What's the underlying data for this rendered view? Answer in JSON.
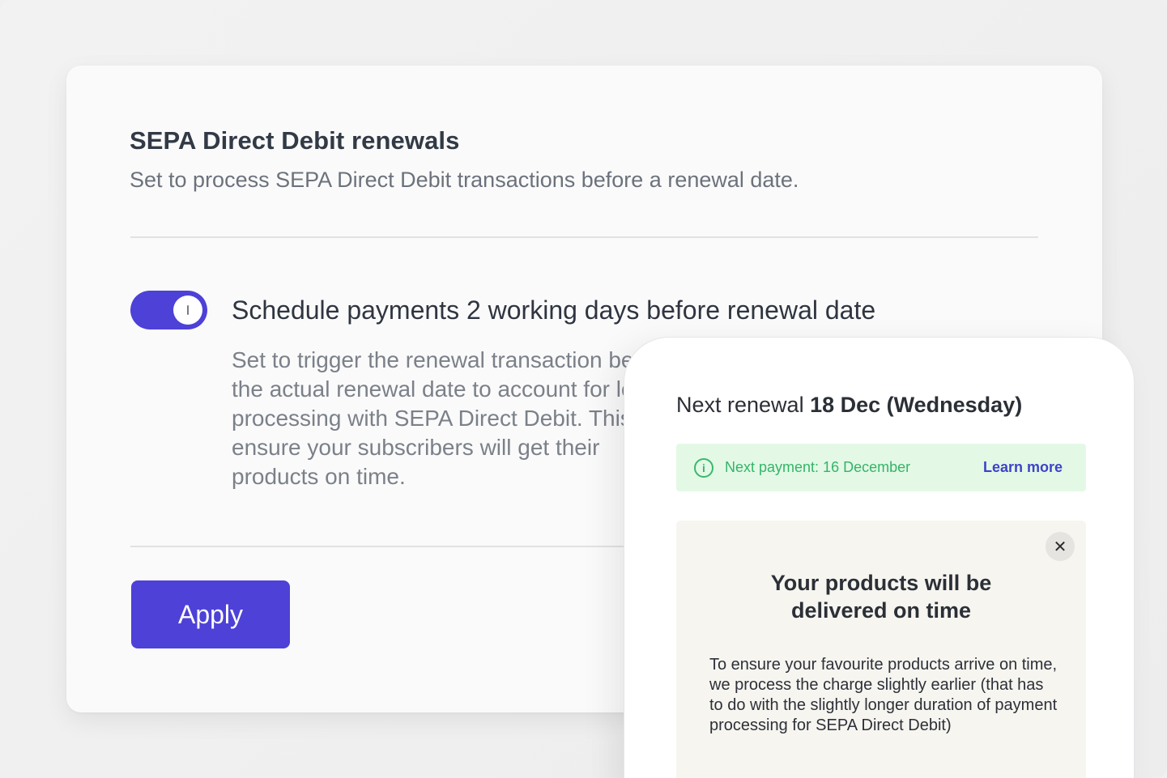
{
  "settings": {
    "title": "SEPA Direct Debit renewals",
    "subtitle": "Set to process SEPA Direct Debit transactions before a renewal date.",
    "option": {
      "enabled": true,
      "title": "Schedule payments 2 working days before renewal date",
      "description": "Set to trigger the renewal transaction before the actual renewal date to account for longer processing with SEPA Direct Debit. This will ensure your subscribers will get their products on time."
    },
    "apply_label": "Apply"
  },
  "phone": {
    "renewal_prefix": "Next renewal",
    "renewal_date": "18 Dec (Wednesday)",
    "banner": {
      "icon": "info-icon",
      "text": "Next payment: 16 December",
      "link": "Learn more"
    },
    "notice": {
      "close_icon": "close-icon",
      "close_symbol": "✕",
      "title_line1": "Your products will be",
      "title_line2": "delivered on time",
      "body": "To ensure your favourite products arrive on time, we process the charge slightly earlier (that has to do with the slightly longer duration of payment processing for SEPA Direct Debit)"
    }
  },
  "colors": {
    "accent": "#4d41d8",
    "success_bg": "#e3f9e6",
    "success_text": "#35b468",
    "link": "#3e43c8"
  }
}
